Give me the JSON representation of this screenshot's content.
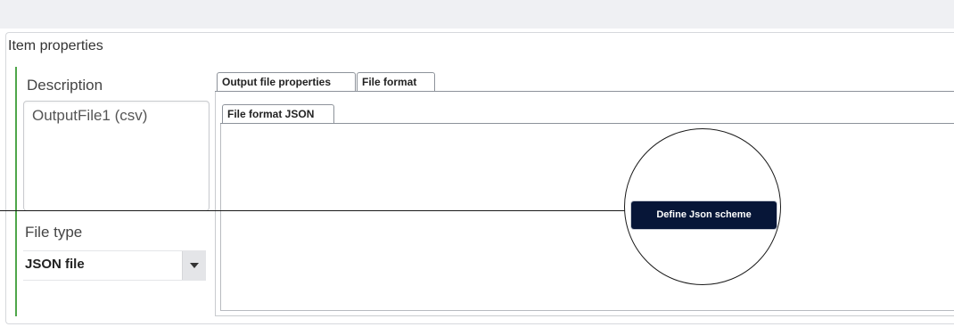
{
  "panel": {
    "title": "Item properties"
  },
  "description": {
    "label": "Description",
    "value": "OutputFile1 (csv)"
  },
  "file_type": {
    "label": "File type",
    "selected": "JSON file"
  },
  "tabs": [
    {
      "label": "Output file properties"
    },
    {
      "label": "File format"
    }
  ],
  "inner_tabs": [
    {
      "label": "File format JSON"
    }
  ],
  "actions": {
    "define_json_label": "Define Json scheme"
  },
  "colors": {
    "accent_green": "#4fa64a",
    "button_navy": "#071638"
  }
}
